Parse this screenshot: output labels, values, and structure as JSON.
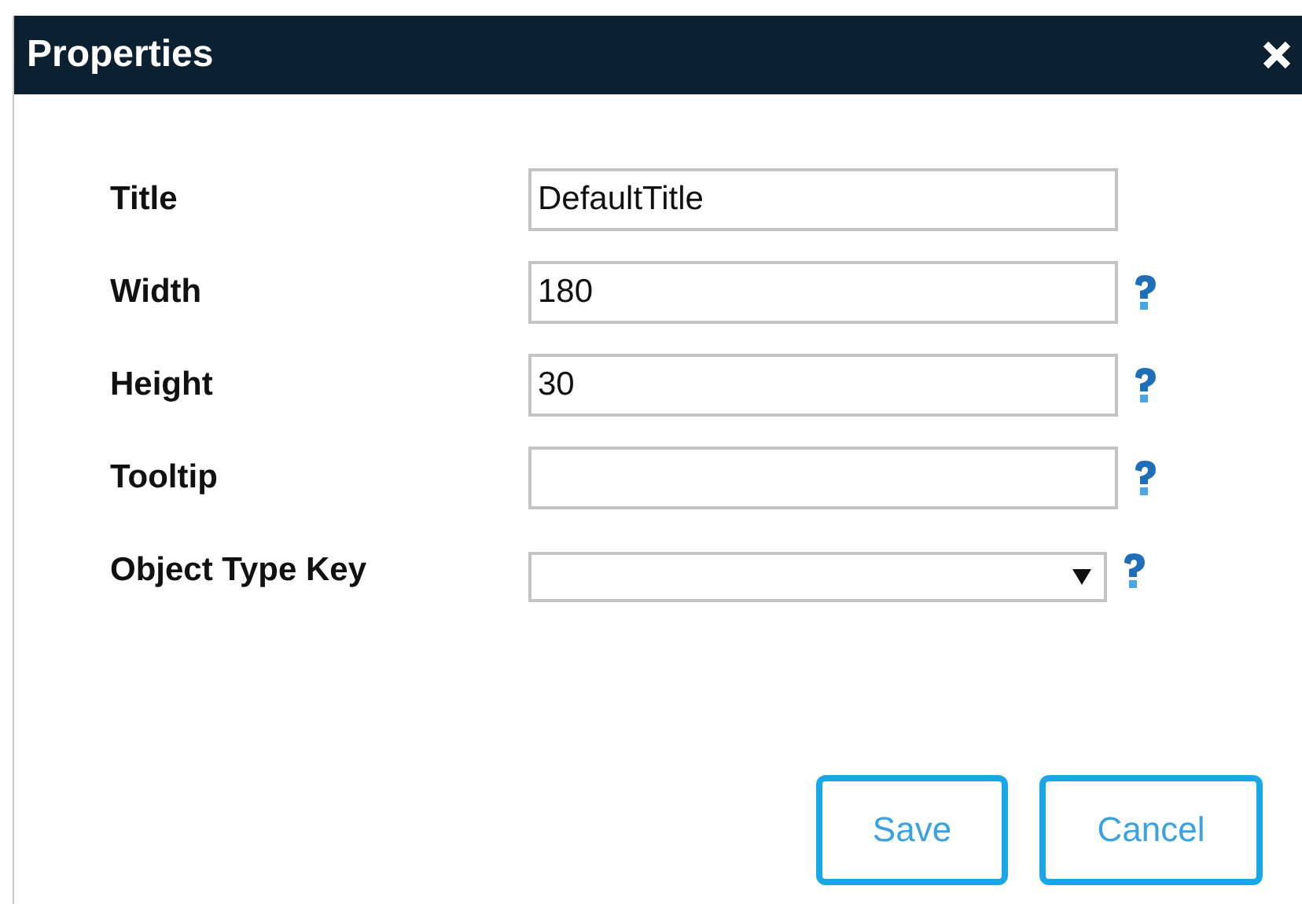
{
  "window": {
    "title": "Properties"
  },
  "fields": [
    {
      "kind": "text",
      "label": "Title",
      "value": "DefaultTitle",
      "help": false
    },
    {
      "kind": "text",
      "label": "Width",
      "value": "180",
      "help": true
    },
    {
      "kind": "text",
      "label": "Height",
      "value": "30",
      "help": true
    },
    {
      "kind": "text",
      "label": "Tooltip",
      "help": true
    },
    {
      "kind": "select",
      "label": "Object Type Key",
      "help": true
    }
  ],
  "buttons": [
    "Save",
    "Cancel"
  ]
}
